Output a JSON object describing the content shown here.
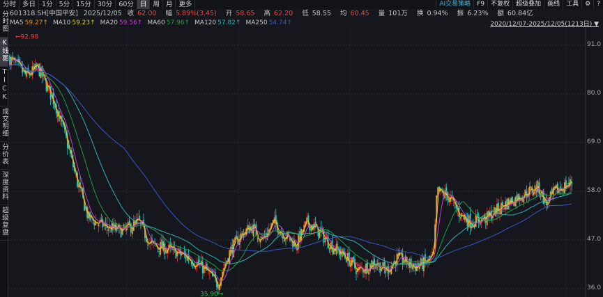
{
  "tabs": [
    "分时",
    "多日",
    "1分",
    "5分",
    "15分",
    "30分",
    "60分",
    "日",
    "周",
    "月",
    "更多"
  ],
  "active_tab": "日",
  "tools": [
    "AI交易策略",
    "F9",
    "不复权",
    "超级叠加",
    "画线",
    "工具"
  ],
  "tool_icons": [
    "gear-icon",
    "help-icon"
  ],
  "sidebar": [
    {
      "label": "分时图"
    },
    {
      "label": "K线图",
      "active": true
    },
    {
      "label": "TICK"
    },
    {
      "label": "成交明细"
    },
    {
      "label": "分价表"
    },
    {
      "label": "深度资料"
    },
    {
      "label": "超级复盘"
    }
  ],
  "quote": {
    "symbol": "601318.SH[中国平安]",
    "date": "2025/12/05",
    "close_label": "收",
    "close": "62.00",
    "change_label": "幅",
    "change": "5.89%(3.45)",
    "open_label": "开",
    "open": "58.65",
    "high_label": "高",
    "high": "62.20",
    "low_label": "低",
    "low": "58.55",
    "avg_label": "均",
    "avg": "60.45",
    "volume_label": "量",
    "volume": "101万",
    "turnover_label": "换",
    "turnover": "0.94%",
    "amplitude_label": "振",
    "amplitude": "6.23%",
    "amount_label": "额",
    "amount": "60.84亿"
  },
  "ma": [
    {
      "name": "MA5",
      "value": "59.27↑",
      "color": "#e8912a"
    },
    {
      "name": "MA10",
      "value": "59.23↑",
      "color": "#d6cf2e"
    },
    {
      "name": "MA20",
      "value": "59.56↑",
      "color": "#c63fd0"
    },
    {
      "name": "MA60",
      "value": "57.96↑",
      "color": "#1f9e45"
    },
    {
      "name": "MA120",
      "value": "57.82↑",
      "color": "#2fb3b8"
    },
    {
      "name": "MA250",
      "value": "54.74↑",
      "color": "#3a56c8"
    }
  ],
  "range": "2020/12/07-2025/12/05(1213日)",
  "chart_data": {
    "type": "candlestick",
    "ylim": [
      36,
      94
    ],
    "yticks": [
      "91.0",
      "80.0",
      "69.0",
      "58.0",
      "47.0",
      "36.0"
    ],
    "max_label": "92.98",
    "min_label": "35.90",
    "anchors": [
      [
        0,
        88
      ],
      [
        0.03,
        84
      ],
      [
        0.05,
        86
      ],
      [
        0.08,
        78
      ],
      [
        0.1,
        70
      ],
      [
        0.12,
        60
      ],
      [
        0.14,
        52
      ],
      [
        0.17,
        50
      ],
      [
        0.2,
        49
      ],
      [
        0.23,
        51
      ],
      [
        0.25,
        46
      ],
      [
        0.28,
        45
      ],
      [
        0.32,
        43
      ],
      [
        0.35,
        40
      ],
      [
        0.37,
        37
      ],
      [
        0.39,
        44
      ],
      [
        0.41,
        48
      ],
      [
        0.43,
        50
      ],
      [
        0.45,
        47
      ],
      [
        0.47,
        51
      ],
      [
        0.49,
        48
      ],
      [
        0.51,
        46
      ],
      [
        0.53,
        51
      ],
      [
        0.55,
        49
      ],
      [
        0.57,
        46
      ],
      [
        0.6,
        43
      ],
      [
        0.62,
        40
      ],
      [
        0.65,
        42
      ],
      [
        0.67,
        40
      ],
      [
        0.69,
        43
      ],
      [
        0.72,
        41
      ],
      [
        0.745,
        42
      ],
      [
        0.755,
        44
      ],
      [
        0.76,
        58
      ],
      [
        0.78,
        57
      ],
      [
        0.8,
        53
      ],
      [
        0.82,
        51
      ],
      [
        0.85,
        52
      ],
      [
        0.88,
        55
      ],
      [
        0.91,
        57
      ],
      [
        0.94,
        59
      ],
      [
        0.955,
        55
      ],
      [
        0.97,
        58
      ],
      [
        0.985,
        59
      ],
      [
        1,
        60
      ]
    ],
    "up_color": "#ff3030",
    "down_color": "#19d4d4"
  }
}
